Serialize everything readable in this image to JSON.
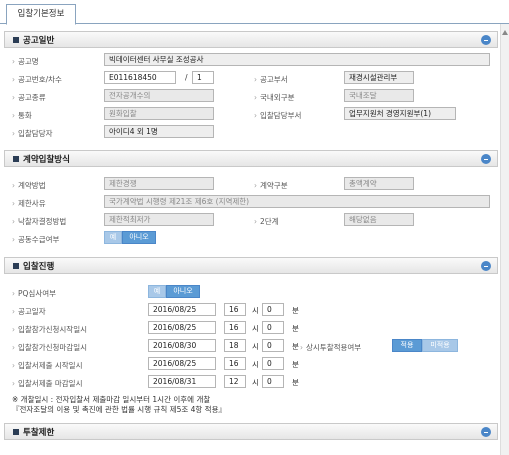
{
  "tab": {
    "label": "입찰기본정보"
  },
  "s1": {
    "title": "공고일반",
    "name_label": "공고명",
    "name_value": "빅데이터센터 사무실 조성공사",
    "no_label": "공고번호/차수",
    "no_value": "E011618450",
    "slash": "/",
    "round_value": "1",
    "dept_label": "공고부서",
    "dept_value": "재경시설관리부",
    "kind_label": "공고종류",
    "kind_value": "전자공개수의",
    "domestic_label": "국내외구분",
    "domestic_value": "국내조달",
    "currency_label": "통화",
    "currency_value": "원화입찰",
    "bid_dept_label": "입찰담당부서",
    "bid_dept_value": "업무지원처 경영지원부(1)",
    "manager_label": "입찰담당자",
    "manager_value": "아이디4 외 1명"
  },
  "s2": {
    "title": "계약입찰방식",
    "method_label": "계약방법",
    "method_value": "제한경쟁",
    "type_label": "계약구분",
    "type_value": "총액계약",
    "reason_label": "제한사유",
    "reason_value": "국가계약법 시행령 제21조 제6호 (지역제한)",
    "winner_label": "낙찰자결정방법",
    "winner_value": "제한적최저가",
    "two_stage_label": "2단계",
    "two_stage_value": "해당없음",
    "joint_label": "공동수급여부",
    "yes": "예",
    "no": "아니오"
  },
  "s3": {
    "title": "입찰진행",
    "pq_label": "PQ심사여부",
    "yes": "예",
    "no": "아니오",
    "hour_unit": "시",
    "min_unit": "분",
    "rows": [
      {
        "label": "공고일자",
        "date": "2016/08/25",
        "hour": "16",
        "min": "0"
      },
      {
        "label": "입찰참가신청시작일시",
        "date": "2016/08/25",
        "hour": "16",
        "min": "0"
      },
      {
        "label": "입찰참가신청마감일시",
        "date": "2016/08/30",
        "hour": "18",
        "min": "0"
      },
      {
        "label": "입찰서제출 시작일시",
        "date": "2016/08/25",
        "hour": "16",
        "min": "0"
      },
      {
        "label": "입찰서제출 마감일시",
        "date": "2016/08/31",
        "hour": "12",
        "min": "0"
      }
    ],
    "bid_label": "상시투찰적용여부",
    "apply": "적용",
    "not_apply": "미적용",
    "note1": "※ 개찰일시 : 전자입찰서 제출마감 일시부터 1시간 이후에 개찰",
    "note2": "『전자조달의 이용 및 촉진에 관한 법률 시행 규칙 제5조 4항 적용』"
  },
  "s4": {
    "title": "투찰제한"
  }
}
